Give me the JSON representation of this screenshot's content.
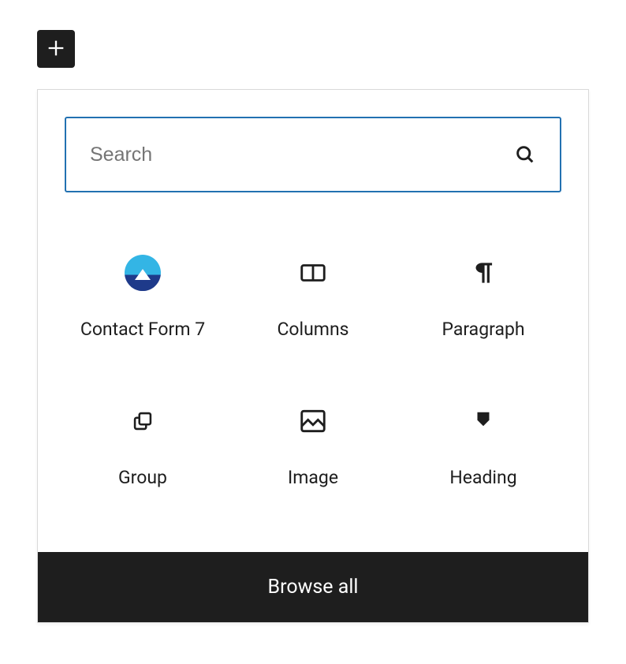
{
  "search": {
    "placeholder": "Search",
    "value": ""
  },
  "blocks": [
    {
      "label": "Contact Form 7",
      "icon": "contact-form-7-icon"
    },
    {
      "label": "Columns",
      "icon": "columns-icon"
    },
    {
      "label": "Paragraph",
      "icon": "paragraph-icon"
    },
    {
      "label": "Group",
      "icon": "group-icon"
    },
    {
      "label": "Image",
      "icon": "image-icon"
    },
    {
      "label": "Heading",
      "icon": "heading-icon"
    }
  ],
  "browse_all_label": "Browse all",
  "colors": {
    "accent": "#2271b1",
    "dark": "#1e1e1e",
    "placeholder": "#757575"
  }
}
